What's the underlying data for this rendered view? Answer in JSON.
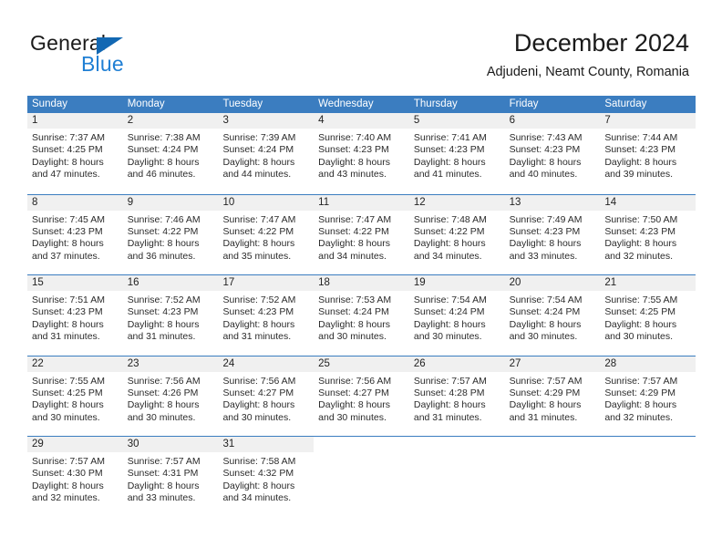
{
  "brand": {
    "name_top": "General",
    "name_bottom": "Blue",
    "accent_color": "#1f7fd4",
    "triangle_color": "#1268b3"
  },
  "header": {
    "title": "December 2024",
    "subtitle": "Adjudeni, Neamt County, Romania"
  },
  "theme": {
    "header_row_bg": "#3b7dc0",
    "daynum_bg": "#f0f0f0",
    "text_color": "#2b2b2b"
  },
  "weekday_headers": [
    "Sunday",
    "Monday",
    "Tuesday",
    "Wednesday",
    "Thursday",
    "Friday",
    "Saturday"
  ],
  "weeks": [
    [
      {
        "day": "1",
        "sunrise": "Sunrise: 7:37 AM",
        "sunset": "Sunset: 4:25 PM",
        "daylight_1": "Daylight: 8 hours",
        "daylight_2": "and 47 minutes."
      },
      {
        "day": "2",
        "sunrise": "Sunrise: 7:38 AM",
        "sunset": "Sunset: 4:24 PM",
        "daylight_1": "Daylight: 8 hours",
        "daylight_2": "and 46 minutes."
      },
      {
        "day": "3",
        "sunrise": "Sunrise: 7:39 AM",
        "sunset": "Sunset: 4:24 PM",
        "daylight_1": "Daylight: 8 hours",
        "daylight_2": "and 44 minutes."
      },
      {
        "day": "4",
        "sunrise": "Sunrise: 7:40 AM",
        "sunset": "Sunset: 4:23 PM",
        "daylight_1": "Daylight: 8 hours",
        "daylight_2": "and 43 minutes."
      },
      {
        "day": "5",
        "sunrise": "Sunrise: 7:41 AM",
        "sunset": "Sunset: 4:23 PM",
        "daylight_1": "Daylight: 8 hours",
        "daylight_2": "and 41 minutes."
      },
      {
        "day": "6",
        "sunrise": "Sunrise: 7:43 AM",
        "sunset": "Sunset: 4:23 PM",
        "daylight_1": "Daylight: 8 hours",
        "daylight_2": "and 40 minutes."
      },
      {
        "day": "7",
        "sunrise": "Sunrise: 7:44 AM",
        "sunset": "Sunset: 4:23 PM",
        "daylight_1": "Daylight: 8 hours",
        "daylight_2": "and 39 minutes."
      }
    ],
    [
      {
        "day": "8",
        "sunrise": "Sunrise: 7:45 AM",
        "sunset": "Sunset: 4:23 PM",
        "daylight_1": "Daylight: 8 hours",
        "daylight_2": "and 37 minutes."
      },
      {
        "day": "9",
        "sunrise": "Sunrise: 7:46 AM",
        "sunset": "Sunset: 4:22 PM",
        "daylight_1": "Daylight: 8 hours",
        "daylight_2": "and 36 minutes."
      },
      {
        "day": "10",
        "sunrise": "Sunrise: 7:47 AM",
        "sunset": "Sunset: 4:22 PM",
        "daylight_1": "Daylight: 8 hours",
        "daylight_2": "and 35 minutes."
      },
      {
        "day": "11",
        "sunrise": "Sunrise: 7:47 AM",
        "sunset": "Sunset: 4:22 PM",
        "daylight_1": "Daylight: 8 hours",
        "daylight_2": "and 34 minutes."
      },
      {
        "day": "12",
        "sunrise": "Sunrise: 7:48 AM",
        "sunset": "Sunset: 4:22 PM",
        "daylight_1": "Daylight: 8 hours",
        "daylight_2": "and 34 minutes."
      },
      {
        "day": "13",
        "sunrise": "Sunrise: 7:49 AM",
        "sunset": "Sunset: 4:23 PM",
        "daylight_1": "Daylight: 8 hours",
        "daylight_2": "and 33 minutes."
      },
      {
        "day": "14",
        "sunrise": "Sunrise: 7:50 AM",
        "sunset": "Sunset: 4:23 PM",
        "daylight_1": "Daylight: 8 hours",
        "daylight_2": "and 32 minutes."
      }
    ],
    [
      {
        "day": "15",
        "sunrise": "Sunrise: 7:51 AM",
        "sunset": "Sunset: 4:23 PM",
        "daylight_1": "Daylight: 8 hours",
        "daylight_2": "and 31 minutes."
      },
      {
        "day": "16",
        "sunrise": "Sunrise: 7:52 AM",
        "sunset": "Sunset: 4:23 PM",
        "daylight_1": "Daylight: 8 hours",
        "daylight_2": "and 31 minutes."
      },
      {
        "day": "17",
        "sunrise": "Sunrise: 7:52 AM",
        "sunset": "Sunset: 4:23 PM",
        "daylight_1": "Daylight: 8 hours",
        "daylight_2": "and 31 minutes."
      },
      {
        "day": "18",
        "sunrise": "Sunrise: 7:53 AM",
        "sunset": "Sunset: 4:24 PM",
        "daylight_1": "Daylight: 8 hours",
        "daylight_2": "and 30 minutes."
      },
      {
        "day": "19",
        "sunrise": "Sunrise: 7:54 AM",
        "sunset": "Sunset: 4:24 PM",
        "daylight_1": "Daylight: 8 hours",
        "daylight_2": "and 30 minutes."
      },
      {
        "day": "20",
        "sunrise": "Sunrise: 7:54 AM",
        "sunset": "Sunset: 4:24 PM",
        "daylight_1": "Daylight: 8 hours",
        "daylight_2": "and 30 minutes."
      },
      {
        "day": "21",
        "sunrise": "Sunrise: 7:55 AM",
        "sunset": "Sunset: 4:25 PM",
        "daylight_1": "Daylight: 8 hours",
        "daylight_2": "and 30 minutes."
      }
    ],
    [
      {
        "day": "22",
        "sunrise": "Sunrise: 7:55 AM",
        "sunset": "Sunset: 4:25 PM",
        "daylight_1": "Daylight: 8 hours",
        "daylight_2": "and 30 minutes."
      },
      {
        "day": "23",
        "sunrise": "Sunrise: 7:56 AM",
        "sunset": "Sunset: 4:26 PM",
        "daylight_1": "Daylight: 8 hours",
        "daylight_2": "and 30 minutes."
      },
      {
        "day": "24",
        "sunrise": "Sunrise: 7:56 AM",
        "sunset": "Sunset: 4:27 PM",
        "daylight_1": "Daylight: 8 hours",
        "daylight_2": "and 30 minutes."
      },
      {
        "day": "25",
        "sunrise": "Sunrise: 7:56 AM",
        "sunset": "Sunset: 4:27 PM",
        "daylight_1": "Daylight: 8 hours",
        "daylight_2": "and 30 minutes."
      },
      {
        "day": "26",
        "sunrise": "Sunrise: 7:57 AM",
        "sunset": "Sunset: 4:28 PM",
        "daylight_1": "Daylight: 8 hours",
        "daylight_2": "and 31 minutes."
      },
      {
        "day": "27",
        "sunrise": "Sunrise: 7:57 AM",
        "sunset": "Sunset: 4:29 PM",
        "daylight_1": "Daylight: 8 hours",
        "daylight_2": "and 31 minutes."
      },
      {
        "day": "28",
        "sunrise": "Sunrise: 7:57 AM",
        "sunset": "Sunset: 4:29 PM",
        "daylight_1": "Daylight: 8 hours",
        "daylight_2": "and 32 minutes."
      }
    ],
    [
      {
        "day": "29",
        "sunrise": "Sunrise: 7:57 AM",
        "sunset": "Sunset: 4:30 PM",
        "daylight_1": "Daylight: 8 hours",
        "daylight_2": "and 32 minutes."
      },
      {
        "day": "30",
        "sunrise": "Sunrise: 7:57 AM",
        "sunset": "Sunset: 4:31 PM",
        "daylight_1": "Daylight: 8 hours",
        "daylight_2": "and 33 minutes."
      },
      {
        "day": "31",
        "sunrise": "Sunrise: 7:58 AM",
        "sunset": "Sunset: 4:32 PM",
        "daylight_1": "Daylight: 8 hours",
        "daylight_2": "and 34 minutes."
      },
      {
        "day": "",
        "sunrise": "",
        "sunset": "",
        "daylight_1": "",
        "daylight_2": ""
      },
      {
        "day": "",
        "sunrise": "",
        "sunset": "",
        "daylight_1": "",
        "daylight_2": ""
      },
      {
        "day": "",
        "sunrise": "",
        "sunset": "",
        "daylight_1": "",
        "daylight_2": ""
      },
      {
        "day": "",
        "sunrise": "",
        "sunset": "",
        "daylight_1": "",
        "daylight_2": ""
      }
    ]
  ]
}
